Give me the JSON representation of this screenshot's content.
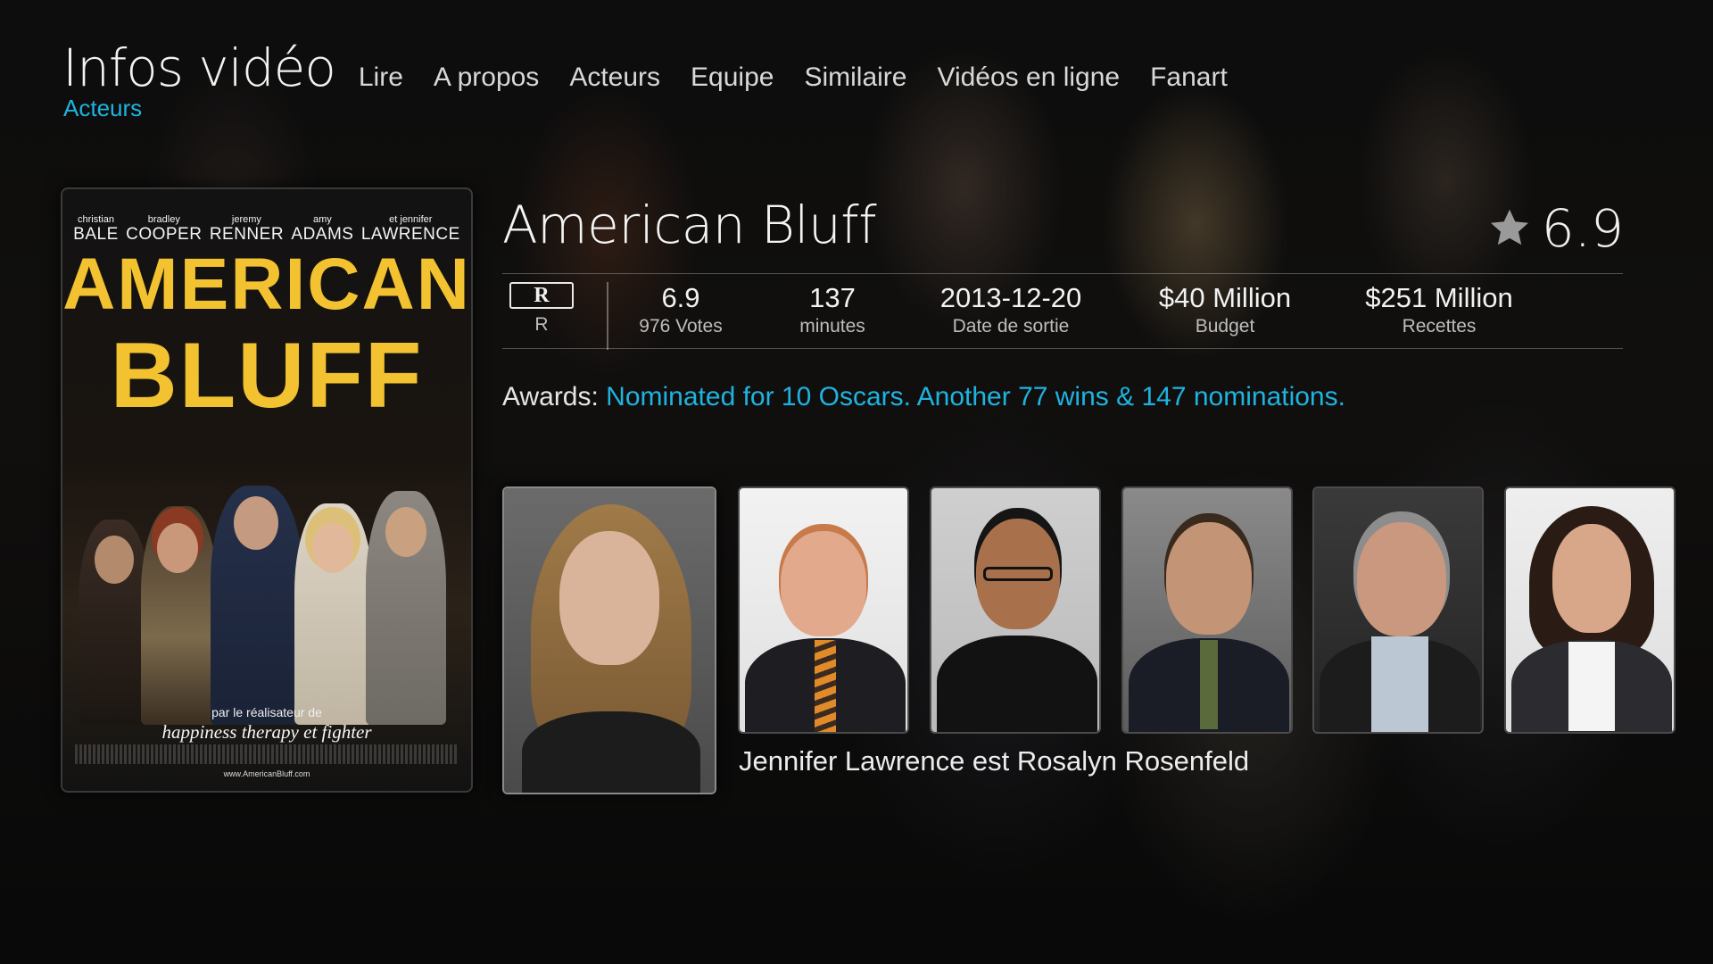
{
  "header": {
    "window_title": "Infos vidéo",
    "subtitle": "Acteurs",
    "tabs": [
      "Lire",
      "A propos",
      "Acteurs",
      "Equipe",
      "Similaire",
      "Vidéos en ligne",
      "Fanart"
    ]
  },
  "poster": {
    "cast": [
      {
        "first": "christian",
        "last": "BALE"
      },
      {
        "first": "bradley",
        "last": "COOPER"
      },
      {
        "first": "jeremy",
        "last": "RENNER"
      },
      {
        "first": "amy",
        "last": "ADAMS"
      },
      {
        "first": "et jennifer",
        "last": "LAWRENCE"
      }
    ],
    "title_line_1": "AMERICAN",
    "title_line_2": "BLUFF",
    "tagline_1": "par le réalisateur de",
    "tagline_2": "happiness therapy et fighter",
    "url": "www.AmericanBluff.com"
  },
  "movie": {
    "title": "American Bluff",
    "rating": "6.9",
    "mpaa_badge": "R",
    "mpaa_label": "R",
    "stats": [
      {
        "value": "6.9",
        "label": "976 Votes"
      },
      {
        "value": "137",
        "label": "minutes"
      },
      {
        "value": "2013-12-20",
        "label": "Date de sortie"
      },
      {
        "value": "$40 Million",
        "label": "Budget"
      },
      {
        "value": "$251 Million",
        "label": "Recettes"
      }
    ],
    "awards_label": "Awards:",
    "awards_text": "Nominated for 10 Oscars. Another 77 wins & 147 nominations."
  },
  "cast": {
    "caption": "Jennifer Lawrence est Rosalyn Rosenfeld",
    "focused_index": 0
  },
  "icons": {
    "rating": "star-icon"
  },
  "colors": {
    "accent": "#1fb3e0",
    "poster_title": "#f2c230"
  }
}
